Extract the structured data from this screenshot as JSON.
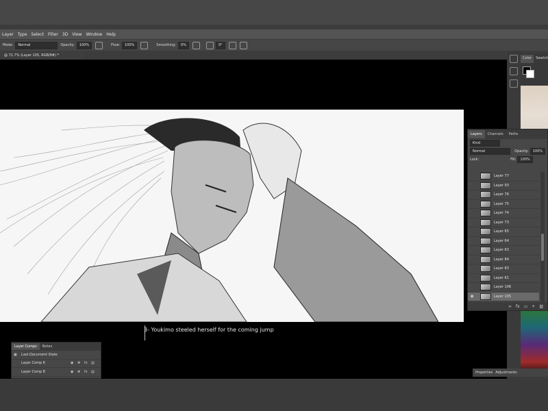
{
  "menu": {
    "items": [
      "Layer",
      "Type",
      "Select",
      "Filter",
      "3D",
      "View",
      "Window",
      "Help"
    ]
  },
  "options": {
    "mode_label": "Mode:",
    "mode_value": "Normal",
    "opacity_label": "Opacity:",
    "opacity_value": "100%",
    "flow_label": "Flow:",
    "flow_value": "100%",
    "smoothing_label": "Smoothing:",
    "smoothing_value": "0%",
    "angle_value": "0°"
  },
  "document": {
    "tab_title": "@ 71.7% (Layer 105, RGB/8#) *"
  },
  "caption": "3- Youkimo steeled herself for the coming jump",
  "color_panel": {
    "tabs": [
      "Color",
      "Swatches"
    ]
  },
  "layers_panel": {
    "tabs": [
      "Layers",
      "Channels",
      "Paths"
    ],
    "kind_label": "Kind",
    "blend_mode": "Normal",
    "opacity_label": "Opacity:",
    "opacity_value": "100%",
    "lock_label": "Lock:",
    "fill_label": "Fill:",
    "fill_value": "100%",
    "layers": [
      {
        "name": "Layer 77",
        "visible": false,
        "selected": false
      },
      {
        "name": "Layer 93",
        "visible": false,
        "selected": false
      },
      {
        "name": "Layer 76",
        "visible": false,
        "selected": false
      },
      {
        "name": "Layer 75",
        "visible": false,
        "selected": false
      },
      {
        "name": "Layer 74",
        "visible": false,
        "selected": false
      },
      {
        "name": "Layer 73",
        "visible": false,
        "selected": false
      },
      {
        "name": "Layer 65",
        "visible": false,
        "selected": false
      },
      {
        "name": "Layer 64",
        "visible": false,
        "selected": false
      },
      {
        "name": "Layer 63",
        "visible": false,
        "selected": false
      },
      {
        "name": "Layer 84",
        "visible": false,
        "selected": false
      },
      {
        "name": "Layer 83",
        "visible": false,
        "selected": false
      },
      {
        "name": "Layer 61",
        "visible": false,
        "selected": false
      },
      {
        "name": "Layer 106",
        "visible": false,
        "selected": false
      },
      {
        "name": "Layer 105",
        "visible": true,
        "selected": true
      }
    ]
  },
  "layer_comps": {
    "tabs": [
      "Layer Comps",
      "Notes"
    ],
    "items": [
      "Last Document State",
      "Layer Comp 6",
      "Layer Comp 8"
    ]
  },
  "properties_tabs": [
    "Properties",
    "Adjustments"
  ]
}
